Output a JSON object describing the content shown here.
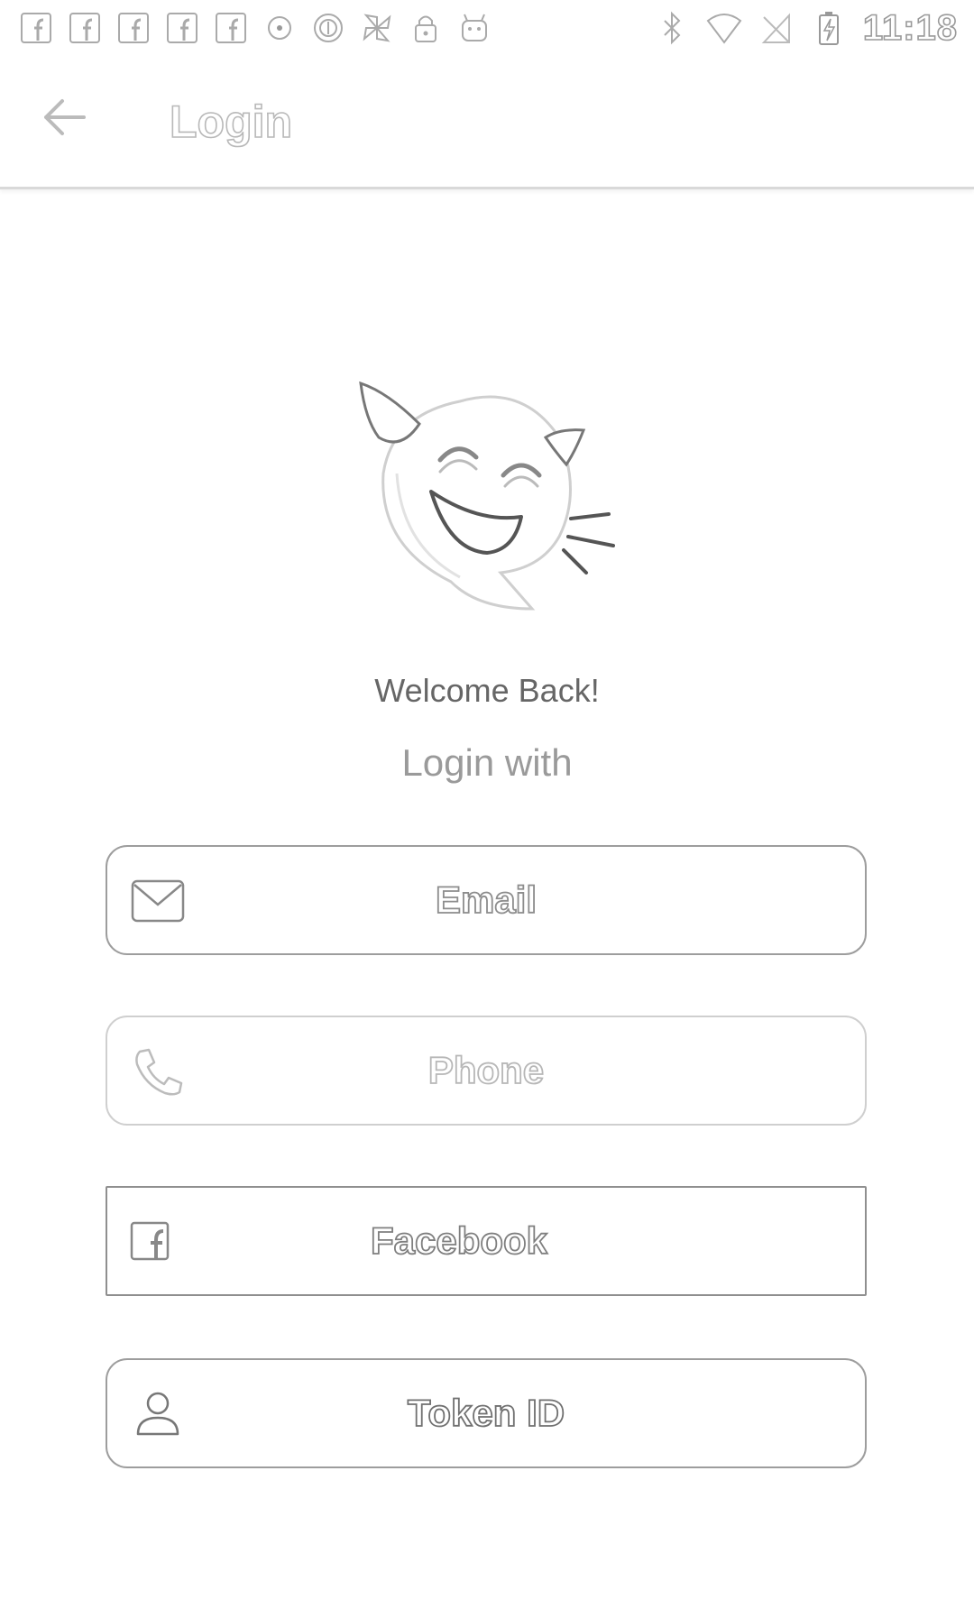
{
  "status_bar": {
    "time": "11:18",
    "left_icons": [
      "facebook-notification-icon",
      "facebook-notification-icon",
      "facebook-notification-icon",
      "facebook-notification-icon",
      "facebook-notification-icon",
      "dot-icon",
      "circle-icon",
      "pinwheel-icon",
      "lock-icon",
      "android-icon"
    ],
    "right_icons": [
      "bluetooth-icon",
      "wifi-icon",
      "no-sim-icon",
      "battery-charging-icon"
    ]
  },
  "app_bar": {
    "title": "Login",
    "back_icon": "arrow-left-icon"
  },
  "main": {
    "welcome": "Welcome Back!",
    "login_with": "Login with",
    "buttons": [
      {
        "label": "Email",
        "icon": "envelope-icon"
      },
      {
        "label": "Phone",
        "icon": "phone-icon"
      },
      {
        "label": "Facebook",
        "icon": "facebook-icon"
      },
      {
        "label": "Token ID",
        "icon": "user-icon"
      }
    ]
  }
}
